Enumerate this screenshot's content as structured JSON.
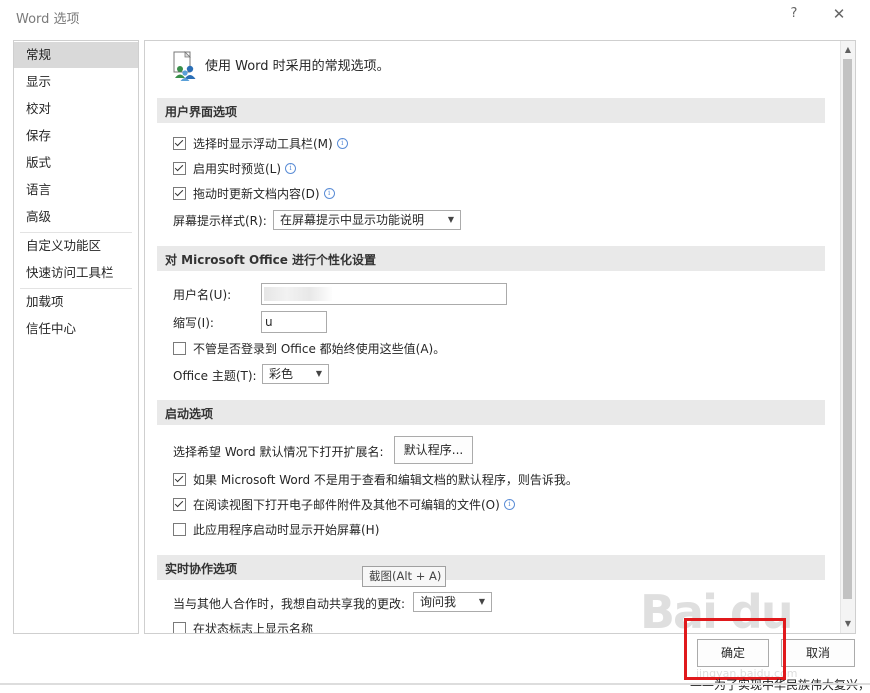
{
  "window": {
    "title": "Word 选项",
    "help": "?",
    "close": "✕"
  },
  "nav": {
    "items": [
      {
        "label": "常规"
      },
      {
        "label": "显示"
      },
      {
        "label": "校对"
      },
      {
        "label": "保存"
      },
      {
        "label": "版式"
      },
      {
        "label": "语言"
      },
      {
        "label": "高级"
      },
      {
        "label": "自定义功能区"
      },
      {
        "label": "快速访问工具栏"
      },
      {
        "label": "加载项"
      },
      {
        "label": "信任中心"
      }
    ]
  },
  "header": {
    "text": "使用 Word 时采用的常规选项。"
  },
  "sections": {
    "ui": {
      "title": "用户界面选项",
      "opt1": "选择时显示浮动工具栏(M)",
      "opt2": "启用实时预览(L)",
      "opt3": "拖动时更新文档内容(D)",
      "tooltip_label": "屏幕提示样式(R):",
      "tooltip_value": "在屏幕提示中显示功能说明"
    },
    "personal": {
      "title": "对 Microsoft Office 进行个性化设置",
      "username_label": "用户名(U):",
      "initials_label": "缩写(I):",
      "initials_value": "u",
      "always_use": "不管是否登录到 Office 都始终使用这些值(A)。",
      "theme_label": "Office 主题(T):",
      "theme_value": "彩色"
    },
    "startup": {
      "title": "启动选项",
      "default_label": "选择希望 Word 默认情况下打开扩展名:",
      "default_button": "默认程序...",
      "tell_me": "如果 Microsoft Word 不是用于查看和编辑文档的默认程序，则告诉我。",
      "reading_view": "在阅读视图下打开电子邮件附件及其他不可编辑的文件(O)",
      "start_screen": "此应用程序启动时显示开始屏幕(H)"
    },
    "coauthor": {
      "title": "实时协作选项",
      "share_label": "当与其他人合作时，我想自动共享我的更改:",
      "share_value": "询问我",
      "show_names": "在状态标志上显示名称"
    }
  },
  "tooltip": "截图(Alt + A)",
  "buttons": {
    "ok": "确定",
    "cancel": "取消"
  },
  "watermark": "Bai du",
  "watermark_sub": "jingyan.baidu.com",
  "footer_text": "——为了实现中华民族伟大复兴，中国共产党团结带领中国人民，浴血奋战，百折不挠"
}
